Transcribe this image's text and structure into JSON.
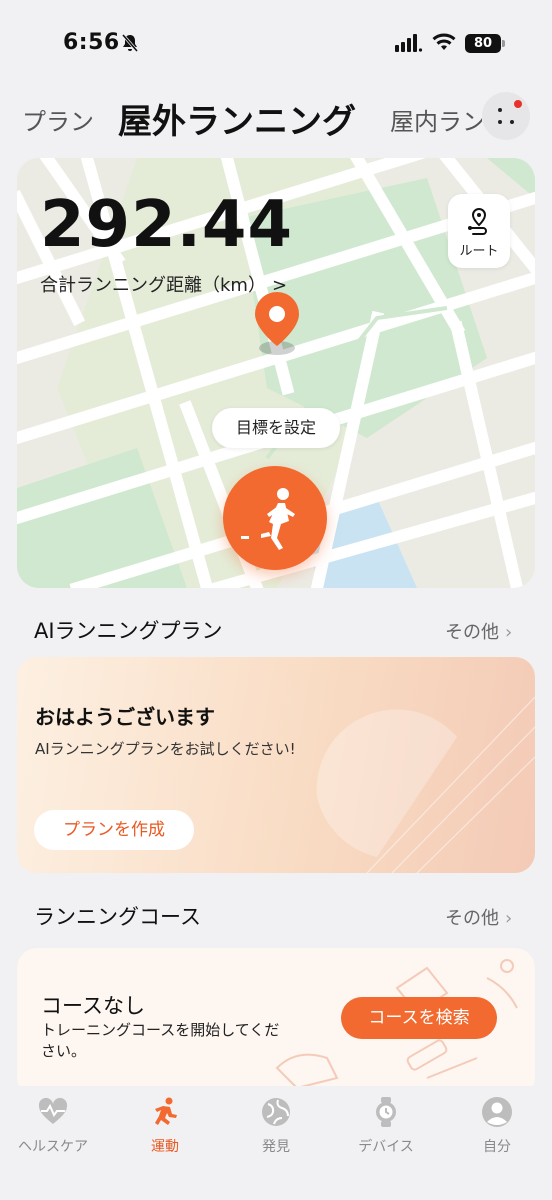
{
  "status_bar": {
    "time": "6:56",
    "battery": "80"
  },
  "header": {
    "tab_left": "プラン",
    "tab_active": "屋外ランニング",
    "tab_right": "屋内ランニング"
  },
  "map_card": {
    "distance": "292.44",
    "distance_label": "合計ランニング距離（km）",
    "route_label": "ルート",
    "goal_label": "目標を設定"
  },
  "ai_plan": {
    "section_title": "AIランニングプラン",
    "more_label": "その他",
    "greeting": "おはようございます",
    "description": "AIランニングプランをお試しください!",
    "button": "プランを作成"
  },
  "courses": {
    "section_title": "ランニングコース",
    "more_label": "その他",
    "empty_title": "コースなし",
    "empty_desc": "トレーニングコースを開始してください。",
    "button": "コースを検索"
  },
  "bottom_nav": {
    "items": [
      {
        "label": "ヘルスケア",
        "icon": "heart-icon",
        "active": false
      },
      {
        "label": "運動",
        "icon": "running-icon",
        "active": true
      },
      {
        "label": "発見",
        "icon": "globe-icon",
        "active": false
      },
      {
        "label": "デバイス",
        "icon": "watch-icon",
        "active": false
      },
      {
        "label": "自分",
        "icon": "person-icon",
        "active": false
      }
    ]
  },
  "colors": {
    "accent": "#f26a2f",
    "map_green": "#cfe8cf",
    "map_blue": "#c9e3f3"
  }
}
